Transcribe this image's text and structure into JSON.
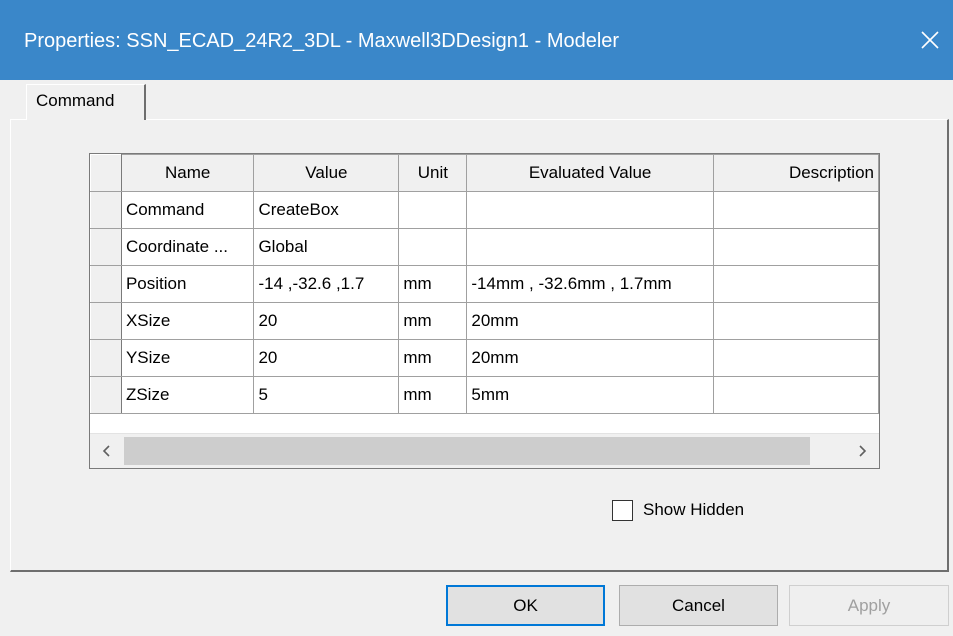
{
  "window": {
    "title": "Properties: SSN_ECAD_24R2_3DL - Maxwell3DDesign1 - Modeler",
    "titlebar_color": "#3a87c9",
    "close_icon": "close-icon"
  },
  "tabs": [
    {
      "label": "Command",
      "active": true
    }
  ],
  "grid": {
    "columns": [
      "Name",
      "Value",
      "Unit",
      "Evaluated Value",
      "Description"
    ],
    "rows": [
      {
        "name": "Command",
        "value": "CreateBox",
        "unit": "",
        "evaluated": "",
        "description": ""
      },
      {
        "name": "Coordinate ...",
        "value": "Global",
        "unit": "",
        "evaluated": "",
        "description": ""
      },
      {
        "name": "Position",
        "value": "-14 ,-32.6 ,1.7",
        "unit": "mm",
        "evaluated": "-14mm , -32.6mm , 1.7mm",
        "description": ""
      },
      {
        "name": "XSize",
        "value": "20",
        "unit": "mm",
        "evaluated": "20mm",
        "description": ""
      },
      {
        "name": "YSize",
        "value": "20",
        "unit": "mm",
        "evaluated": "20mm",
        "description": ""
      },
      {
        "name": "ZSize",
        "value": "5",
        "unit": "mm",
        "evaluated": "5mm",
        "description": ""
      }
    ],
    "scroll_left_icon": "chevron-left-icon",
    "scroll_right_icon": "chevron-right-icon"
  },
  "show_hidden": {
    "label": "Show Hidden",
    "checked": false
  },
  "buttons": {
    "ok": "OK",
    "cancel": "Cancel",
    "apply": "Apply",
    "apply_enabled": false
  }
}
